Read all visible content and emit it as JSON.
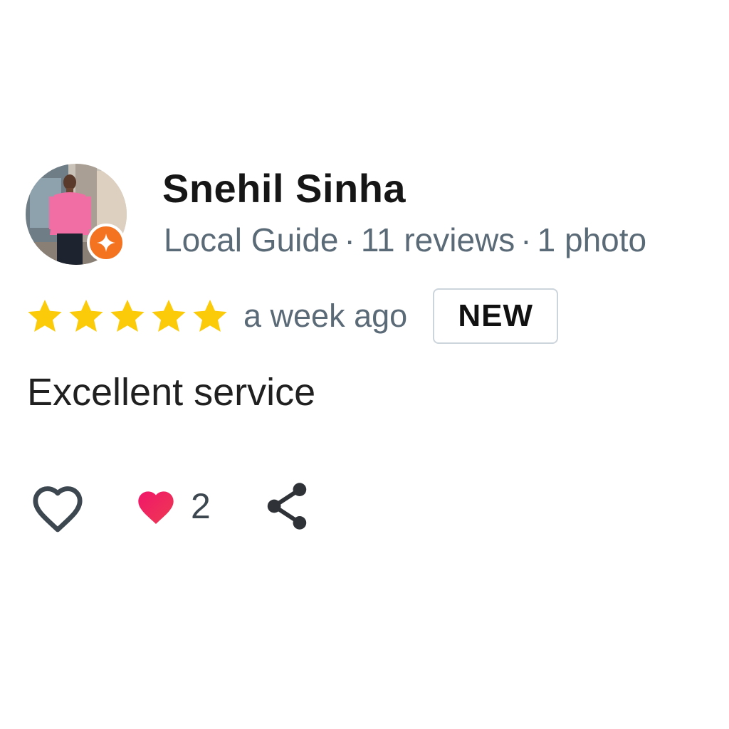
{
  "reviewer": {
    "name": "Snehil Sinha",
    "badge": "Local Guide",
    "reviews": "11 reviews",
    "photos": "1 photo",
    "separator": "·",
    "avatar_icon": "local-guide-badge-icon",
    "badge_color": "#f37321"
  },
  "rating": {
    "stars": 5,
    "max_stars": 5,
    "star_color": "#fbcb0a",
    "time_ago": "a week ago",
    "new_label": "NEW"
  },
  "review": {
    "text": "Excellent service"
  },
  "actions": {
    "like_icon": "heart-outline-icon",
    "liked_icon": "heart-filled-icon",
    "like_count": "2",
    "share_icon": "share-icon",
    "liked_color": "#ee1d5e"
  }
}
